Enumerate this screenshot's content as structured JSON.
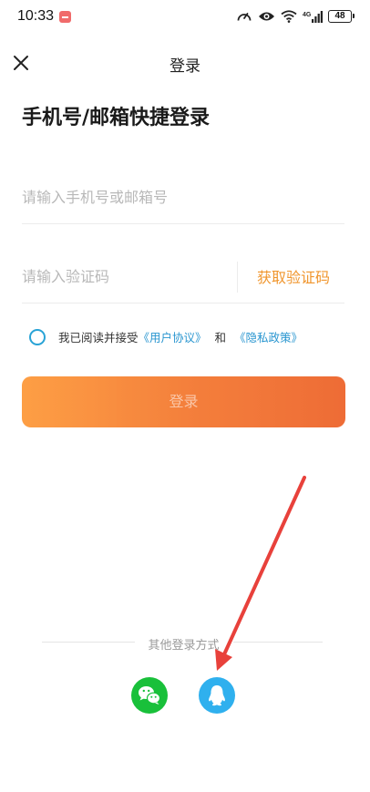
{
  "status_bar": {
    "time": "10:33",
    "battery": "48",
    "signal": "4G"
  },
  "header": {
    "title": "登录"
  },
  "main": {
    "title": "手机号/邮箱快捷登录",
    "phone_placeholder": "请输入手机号或邮箱号",
    "code_placeholder": "请输入验证码",
    "get_code_label": "获取验证码",
    "agreement": {
      "prefix": "我已阅读并接受",
      "user_agreement": "《用户协议》",
      "and": "和",
      "privacy_policy": "《隐私政策》"
    },
    "login_button": "登录"
  },
  "other_login": {
    "label": "其他登录方式",
    "methods": [
      "wechat-icon",
      "qq-icon"
    ]
  },
  "colors": {
    "accent_orange": "#f3732b",
    "link_blue": "#2a96d0",
    "wechat_green": "#19c03a",
    "qq_blue": "#2fb0ee",
    "annotation_red": "#e8413b"
  }
}
